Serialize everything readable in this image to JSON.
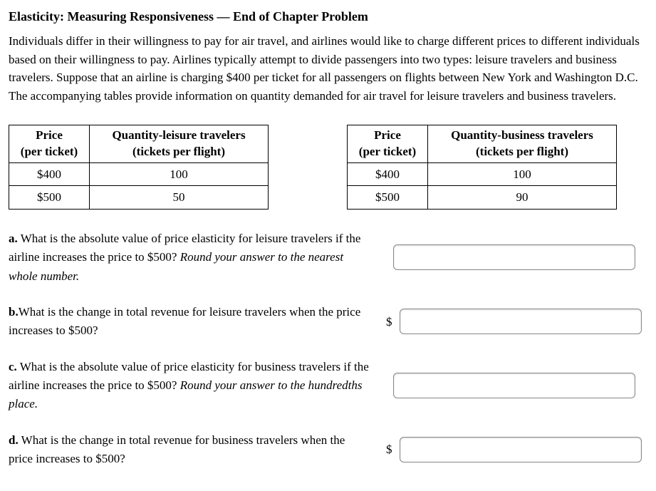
{
  "title": "Elasticity: Measuring Responsiveness — End of Chapter Problem",
  "intro": "Individuals differ in their willingness to pay for air travel, and airlines would like to charge different prices to different individuals based on their willingness to pay. Airlines typically attempt to divide passengers into two types: leisure travelers and business travelers. Suppose that an airline is charging $400 per ticket for all passengers on flights between New York and Washington D.C. The accompanying tables provide information on quantity demanded for air travel for leisure travelers and business travelers.",
  "table_leisure": {
    "col1_header_l1": "Price",
    "col1_header_l2": "(per ticket)",
    "col2_header_l1": "Quantity-leisure travelers",
    "col2_header_l2": "(tickets per flight)",
    "rows": [
      {
        "price": "$400",
        "qty": "100"
      },
      {
        "price": "$500",
        "qty": "50"
      }
    ]
  },
  "table_business": {
    "col1_header_l1": "Price",
    "col1_header_l2": "(per ticket)",
    "col2_header_l1": "Quantity-business travelers",
    "col2_header_l2": "(tickets per flight)",
    "rows": [
      {
        "price": "$400",
        "qty": "100"
      },
      {
        "price": "$500",
        "qty": "90"
      }
    ]
  },
  "questions": {
    "a": {
      "label": "a.",
      "text": " What is the absolute value of price elasticity for leisure travelers if the airline increases the price to $500? ",
      "hint": "Round your answer to the nearest whole number.",
      "prefix": "",
      "value": ""
    },
    "b": {
      "label": "b.",
      "text": "What is the change in total revenue for leisure travelers when the price increases to $500?",
      "hint": "",
      "prefix": "$",
      "value": ""
    },
    "c": {
      "label": "c.",
      "text": " What is the absolute value of price elasticity for business travelers if the airline increases the price to $500? ",
      "hint": "Round your answer to the hundredths place.",
      "prefix": "",
      "value": ""
    },
    "d": {
      "label": "d.",
      "text": " What is the change in total revenue for business travelers when the price increases to $500?",
      "hint": "",
      "prefix": "$",
      "value": ""
    }
  }
}
